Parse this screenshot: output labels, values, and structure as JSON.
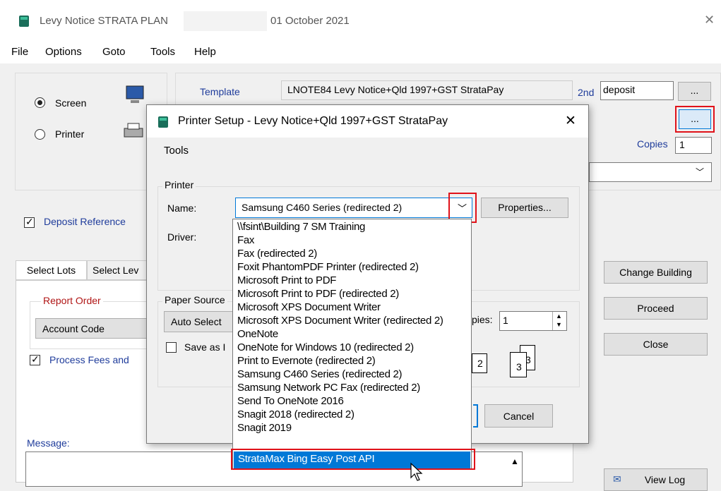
{
  "window": {
    "title_prefix": "Levy Notice STRATA PLAN",
    "title_date": "01 October 2021",
    "close_glyph": "✕"
  },
  "menu": [
    "File",
    "Options",
    "Goto",
    "Tools",
    "Help"
  ],
  "output": {
    "screen_label": "Screen",
    "printer_label": "Printer"
  },
  "template": {
    "label": "Template",
    "value": "LNOTE84 Levy Notice+Qld 1997+GST StrataPay",
    "second_label": "2nd",
    "second_value": "deposit",
    "browse": "...",
    "browse2": "..."
  },
  "copies": {
    "label": "Copies",
    "value": "1"
  },
  "deposit_reference": {
    "label": "Deposit Reference"
  },
  "tabs": [
    "Select Lots",
    "Select Lev"
  ],
  "report_order": {
    "label": "Report Order",
    "value": "Account Code"
  },
  "process_fees": {
    "label": "Process Fees and"
  },
  "message_label": "Message:",
  "buttons": {
    "change_building": "Change Building",
    "proceed": "Proceed",
    "close": "Close",
    "view_log": "View Log"
  },
  "dialog": {
    "title": "Printer Setup - Levy Notice+Qld 1997+GST StrataPay",
    "menu_tools": "Tools",
    "printer_group": "Printer",
    "name_label": "Name:",
    "name_value": "Samsung C460 Series (redirected 2)",
    "driver_label": "Driver:",
    "properties_button": "Properties...",
    "paper_source_label": "Paper Source",
    "paper_source_value": "Auto Select",
    "save_as_label": "Save as I",
    "copies_label": "pies:",
    "copies_value": "1",
    "collate_pages": [
      "2",
      "3",
      "3"
    ],
    "cancel_button": "Cancel"
  },
  "printer_list": [
    "\\\\fsint\\Building 7 SM Training",
    "Fax",
    "Fax (redirected 2)",
    "Foxit PhantomPDF Printer (redirected 2)",
    "Microsoft Print to PDF",
    "Microsoft Print to PDF (redirected 2)",
    "Microsoft XPS Document Writer",
    "Microsoft XPS Document Writer (redirected 2)",
    "OneNote",
    "OneNote for Windows 10 (redirected 2)",
    "Print to Evernote (redirected 2)",
    "Samsung C460 Series (redirected 2)",
    "Samsung Network PC Fax (redirected 2)",
    "Send To OneNote 2016",
    "Snagit 2018 (redirected 2)",
    "Snagit 2019",
    "StrataMax Bing Easy Post API"
  ],
  "selected_printer_index": 16,
  "colors": {
    "accent": "#0078d7",
    "highlight": "#e0121a",
    "label_blue": "#1f3c9b",
    "label_red": "#b01515"
  }
}
